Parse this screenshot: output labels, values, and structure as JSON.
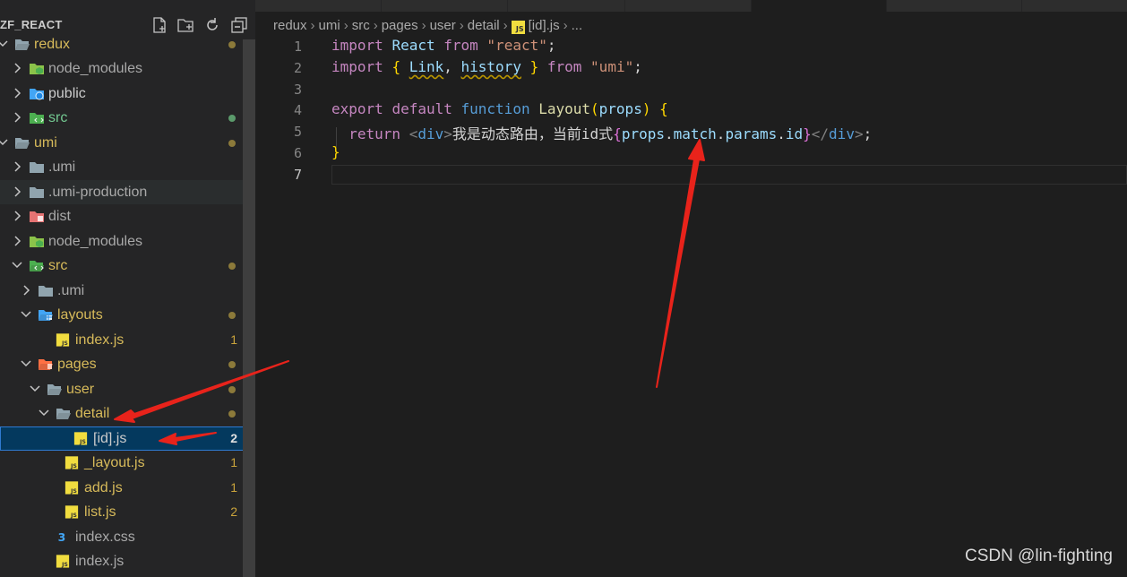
{
  "explorer": {
    "title": "ZF_REACT",
    "actions": [
      "new-file-icon",
      "new-folder-icon",
      "refresh-icon",
      "collapse-all-icon"
    ],
    "tree": [
      {
        "label": "redux",
        "kind": "folder-open",
        "depth": 0,
        "color": "yellow",
        "status": "dot"
      },
      {
        "label": "node_modules",
        "kind": "node-folder",
        "depth": 1,
        "color": "gray",
        "status": ""
      },
      {
        "label": "public",
        "kind": "public-folder",
        "depth": 1,
        "color": "white",
        "status": ""
      },
      {
        "label": "src",
        "kind": "src-folder",
        "depth": 1,
        "color": "green",
        "status": "dot-green"
      },
      {
        "label": "umi",
        "kind": "folder-open",
        "depth": 0,
        "color": "yellow",
        "status": "dot"
      },
      {
        "label": ".umi",
        "kind": "folder",
        "depth": 1,
        "color": "gray",
        "status": ""
      },
      {
        "label": ".umi-production",
        "kind": "folder",
        "depth": 1,
        "color": "gray",
        "status": ""
      },
      {
        "label": "dist",
        "kind": "dist-folder",
        "depth": 1,
        "color": "gray",
        "status": ""
      },
      {
        "label": "node_modules",
        "kind": "node-folder",
        "depth": 1,
        "color": "gray",
        "status": ""
      },
      {
        "label": "src",
        "kind": "src-folder-open",
        "depth": 1,
        "color": "yellow",
        "status": "dot"
      },
      {
        "label": ".umi",
        "kind": "folder",
        "depth": 2,
        "color": "gray",
        "status": ""
      },
      {
        "label": "layouts",
        "kind": "layout-folder-open",
        "depth": 2,
        "color": "yellow",
        "status": "dot"
      },
      {
        "label": "index.js",
        "kind": "js",
        "depth": 3,
        "color": "yellow",
        "status": "1"
      },
      {
        "label": "pages",
        "kind": "pages-folder-open",
        "depth": 2,
        "color": "yellow",
        "status": "dot"
      },
      {
        "label": "user",
        "kind": "folder-open",
        "depth": 3,
        "color": "yellow",
        "status": "dot"
      },
      {
        "label": "detail",
        "kind": "folder-open",
        "depth": 4,
        "color": "yellow",
        "status": "dot"
      },
      {
        "label": "[id].js",
        "kind": "js",
        "depth": 5,
        "color": "white",
        "status": "2"
      },
      {
        "label": "_layout.js",
        "kind": "js",
        "depth": 4,
        "color": "yellow",
        "status": "1"
      },
      {
        "label": "add.js",
        "kind": "js",
        "depth": 4,
        "color": "yellow",
        "status": "1"
      },
      {
        "label": "list.js",
        "kind": "js",
        "depth": 4,
        "color": "yellow",
        "status": "2"
      },
      {
        "label": "index.css",
        "kind": "css",
        "depth": 3,
        "color": "gray",
        "status": ""
      },
      {
        "label": "index.js",
        "kind": "js",
        "depth": 3,
        "color": "gray",
        "status": ""
      }
    ]
  },
  "breadcrumb": {
    "items": [
      "redux",
      "umi",
      "src",
      "pages",
      "user",
      "detail",
      "[id].js",
      "..."
    ]
  },
  "editor": {
    "line_numbers": [
      "1",
      "2",
      "3",
      "4",
      "5",
      "6",
      "7"
    ],
    "lines": [
      [
        [
          "import",
          "kw2"
        ],
        [
          " ",
          "pun"
        ],
        [
          "React",
          "var"
        ],
        [
          " ",
          "pun"
        ],
        [
          "from",
          "kw2"
        ],
        [
          " ",
          "pun"
        ],
        [
          "\"react\"",
          "str"
        ],
        [
          ";",
          "pun"
        ]
      ],
      [
        [
          "import",
          "kw2"
        ],
        [
          " ",
          "pun"
        ],
        [
          "{",
          "br"
        ],
        [
          " ",
          "pun"
        ],
        [
          "Link",
          "var-sq"
        ],
        [
          ", ",
          "pun"
        ],
        [
          "history",
          "var-sq"
        ],
        [
          " ",
          "pun"
        ],
        [
          "}",
          "br"
        ],
        [
          " ",
          "pun"
        ],
        [
          "from",
          "kw2"
        ],
        [
          " ",
          "pun"
        ],
        [
          "\"umi\"",
          "str"
        ],
        [
          ";",
          "pun"
        ]
      ],
      [],
      [
        [
          "export",
          "kw2"
        ],
        [
          " ",
          "pun"
        ],
        [
          "default",
          "kw2"
        ],
        [
          " ",
          "pun"
        ],
        [
          "function",
          "kw"
        ],
        [
          " ",
          "pun"
        ],
        [
          "Layout",
          "fn"
        ],
        [
          "(",
          "br"
        ],
        [
          "props",
          "var"
        ],
        [
          ")",
          "br"
        ],
        [
          " ",
          "pun"
        ],
        [
          "{",
          "br"
        ]
      ],
      [
        [
          "  ",
          "pun"
        ],
        [
          "return",
          "kw2"
        ],
        [
          " ",
          "pun"
        ],
        [
          "<",
          "gray"
        ],
        [
          "div",
          "tag"
        ],
        [
          ">",
          "gray"
        ],
        [
          "我是动态路由，当前id式",
          "txt"
        ],
        [
          "{",
          "br2"
        ],
        [
          "props",
          "var"
        ],
        [
          ".",
          "pun"
        ],
        [
          "match",
          "var"
        ],
        [
          ".",
          "pun"
        ],
        [
          "params",
          "var"
        ],
        [
          ".",
          "pun"
        ],
        [
          "id",
          "var"
        ],
        [
          "}",
          "br2"
        ],
        [
          "</",
          "gray"
        ],
        [
          "div",
          "tag"
        ],
        [
          ">",
          "gray"
        ],
        [
          ";",
          "pun"
        ]
      ],
      [
        [
          "}",
          "br"
        ]
      ],
      []
    ]
  },
  "watermark": "CSDN @lin-fighting"
}
